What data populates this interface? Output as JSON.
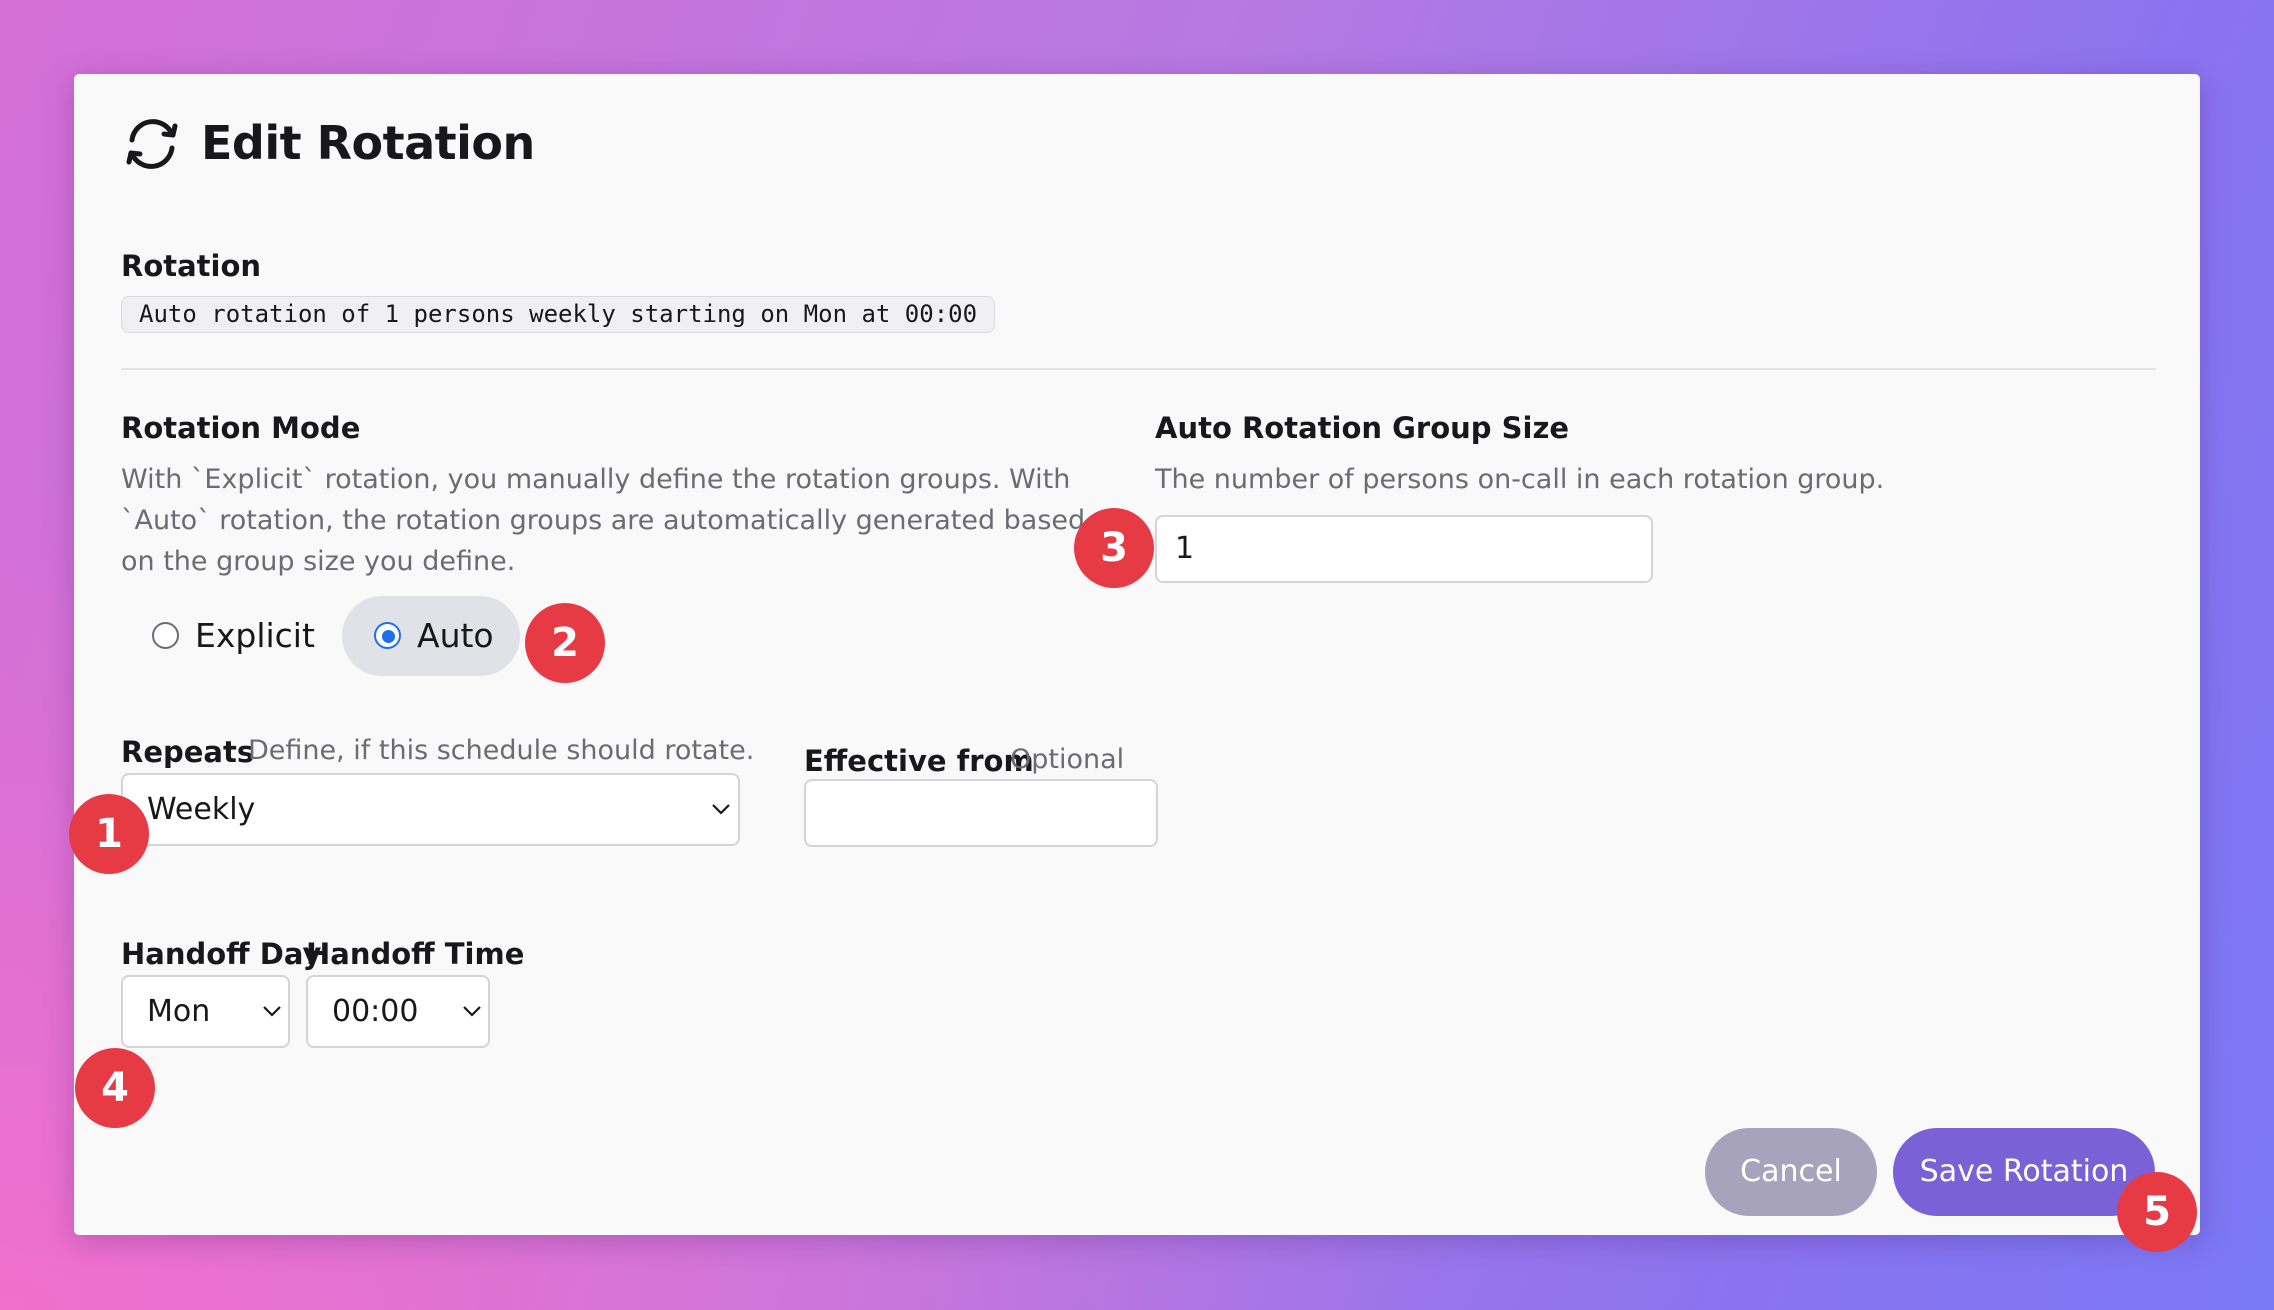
{
  "header": {
    "title": "Edit Rotation",
    "icon": "refresh-icon"
  },
  "rotation_summary": {
    "label": "Rotation",
    "value": "Auto rotation of 1 persons weekly starting on Mon at 00:00"
  },
  "rotation_mode": {
    "label": "Rotation Mode",
    "help": "With `Explicit` rotation, you manually define the rotation groups. With `Auto` rotation, the rotation groups are automatically generated based on the group size you define.",
    "options": [
      {
        "label": "Explicit",
        "selected": false
      },
      {
        "label": "Auto",
        "selected": true
      }
    ]
  },
  "group_size": {
    "label": "Auto Rotation Group Size",
    "help": "The number of persons on-call in each rotation group.",
    "value": "1"
  },
  "repeats": {
    "label": "Repeats",
    "help": "Define, if this schedule should rotate.",
    "value": "Weekly"
  },
  "effective_from": {
    "label": "Effective from",
    "hint": "Optional",
    "value": ""
  },
  "handoff_day": {
    "label": "Handoff Day",
    "value": "Mon"
  },
  "handoff_time": {
    "label": "Handoff Time",
    "value": "00:00"
  },
  "actions": {
    "cancel_label": "Cancel",
    "save_label": "Save Rotation"
  },
  "badges": [
    "1",
    "2",
    "3",
    "4",
    "5"
  ],
  "colors": {
    "accent": "#7a62d6",
    "cancel": "#a8a3bd",
    "badge": "#e63a45",
    "radio": "#1f6feb"
  }
}
